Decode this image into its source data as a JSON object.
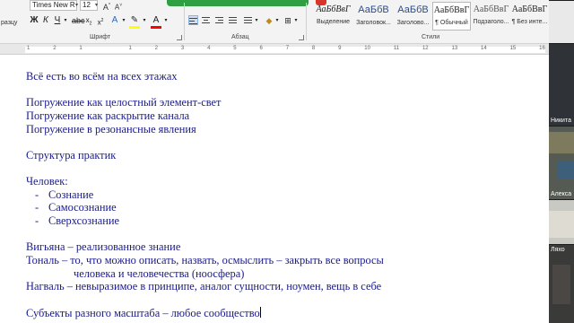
{
  "ribbon": {
    "font_name": "Times New R",
    "font_size": "12",
    "clipboard_partial": "разцу",
    "groups": {
      "font": "Шрифт",
      "paragraph": "Абзац",
      "styles": "Стили"
    },
    "bold": "Ж",
    "italic": "К",
    "underline": "Ч",
    "styles": [
      {
        "sample": "АаБбВвГ",
        "name": "Выделение"
      },
      {
        "sample": "АаБбВ",
        "name": "Заголовок..."
      },
      {
        "sample": "АаБбВ",
        "name": "Заголово..."
      },
      {
        "sample": "АаБбВвГ",
        "name": "¶ Обычный"
      },
      {
        "sample": "АаБбВвГ",
        "name": "Подзаголо..."
      },
      {
        "sample": "АаБбВвГ",
        "name": "¶ Без инте..."
      }
    ],
    "highlight_color": "#ffff00",
    "font_color": "#ff0000"
  },
  "ruler": {
    "numbers": [
      "1",
      "2",
      "1",
      "",
      "1",
      "2",
      "3",
      "4",
      "5",
      "6",
      "7",
      "8",
      "9",
      "10",
      "11",
      "12",
      "13",
      "14",
      "15",
      "16"
    ]
  },
  "document": {
    "text_color": "#1a1a8a",
    "lines": [
      "Всё есть во всём на всех этажах",
      "",
      "Погружение как целостный элемент-свет",
      "Погружение как раскрытие канала",
      "Погружение в резонансные явления",
      "",
      "Структура практик",
      "",
      "Человек:",
      "Сознание",
      "Самосознание",
      "Сверхсознание",
      "",
      "Вигьяна – реализованное знание",
      "Тональ – то, что можно описать, назвать, осмыслить – закрыть все вопросы",
      "человека и человечества (ноосфера)",
      "Нагваль – невыразимое в принципе, аналог сущности, ноумен, вещь в себе",
      "",
      "Субъекты разного масштаба – любое сообщество"
    ]
  },
  "participants": [
    {
      "name": "Никита"
    },
    {
      "name": "Алекса"
    },
    {
      "name": "Ляхо"
    }
  ]
}
